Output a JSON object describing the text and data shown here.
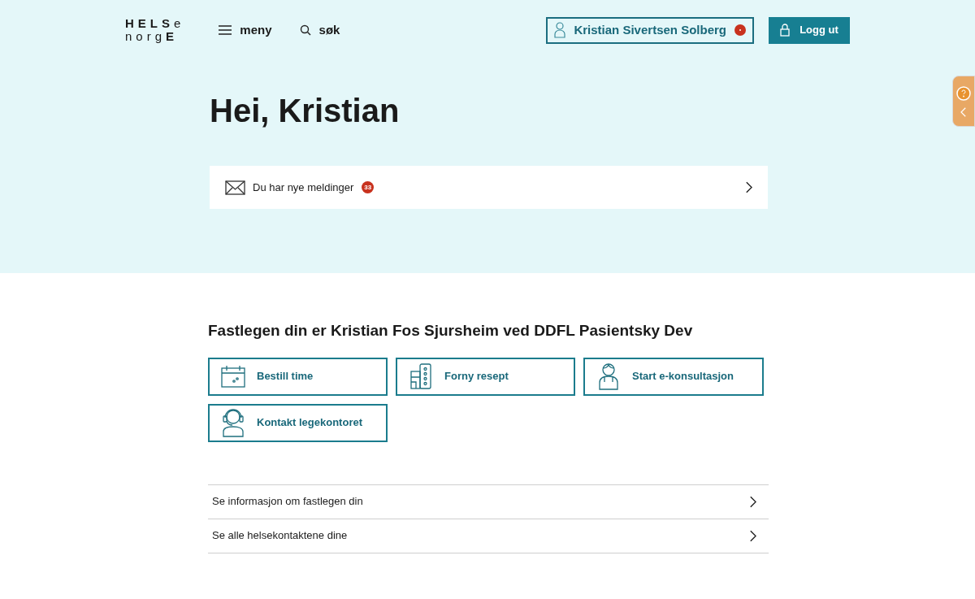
{
  "logo": {
    "line1_bold": "HELS",
    "line1_light": "e",
    "line2_light": "norg",
    "line2_bold": "E"
  },
  "nav": [
    {
      "kind": "menu",
      "label": "meny"
    },
    {
      "kind": "search",
      "label": "søk"
    }
  ],
  "user_button": {
    "label": "Kristian Sivertsen Solberg",
    "notification": true
  },
  "logout_button": {
    "label": "Logg ut"
  },
  "greeting": "Hei, Kristian",
  "messages": {
    "label": "Du har nye meldinger",
    "count": "33"
  },
  "gp_heading": "Fastlegen din er Kristian Fos Sjursheim ved DDFL Pasientsky Dev",
  "actions": [
    {
      "kind": "calendar",
      "label": "Bestill time"
    },
    {
      "kind": "pills",
      "label": "Forny resept"
    },
    {
      "kind": "doctor",
      "label": "Start e-konsultasjon"
    },
    {
      "kind": "headset",
      "label": "Kontakt legekontoret"
    }
  ],
  "links": [
    {
      "label": "Se informasjon om fastlegen din"
    },
    {
      "label": "Se alle helsekontaktene dine"
    }
  ]
}
